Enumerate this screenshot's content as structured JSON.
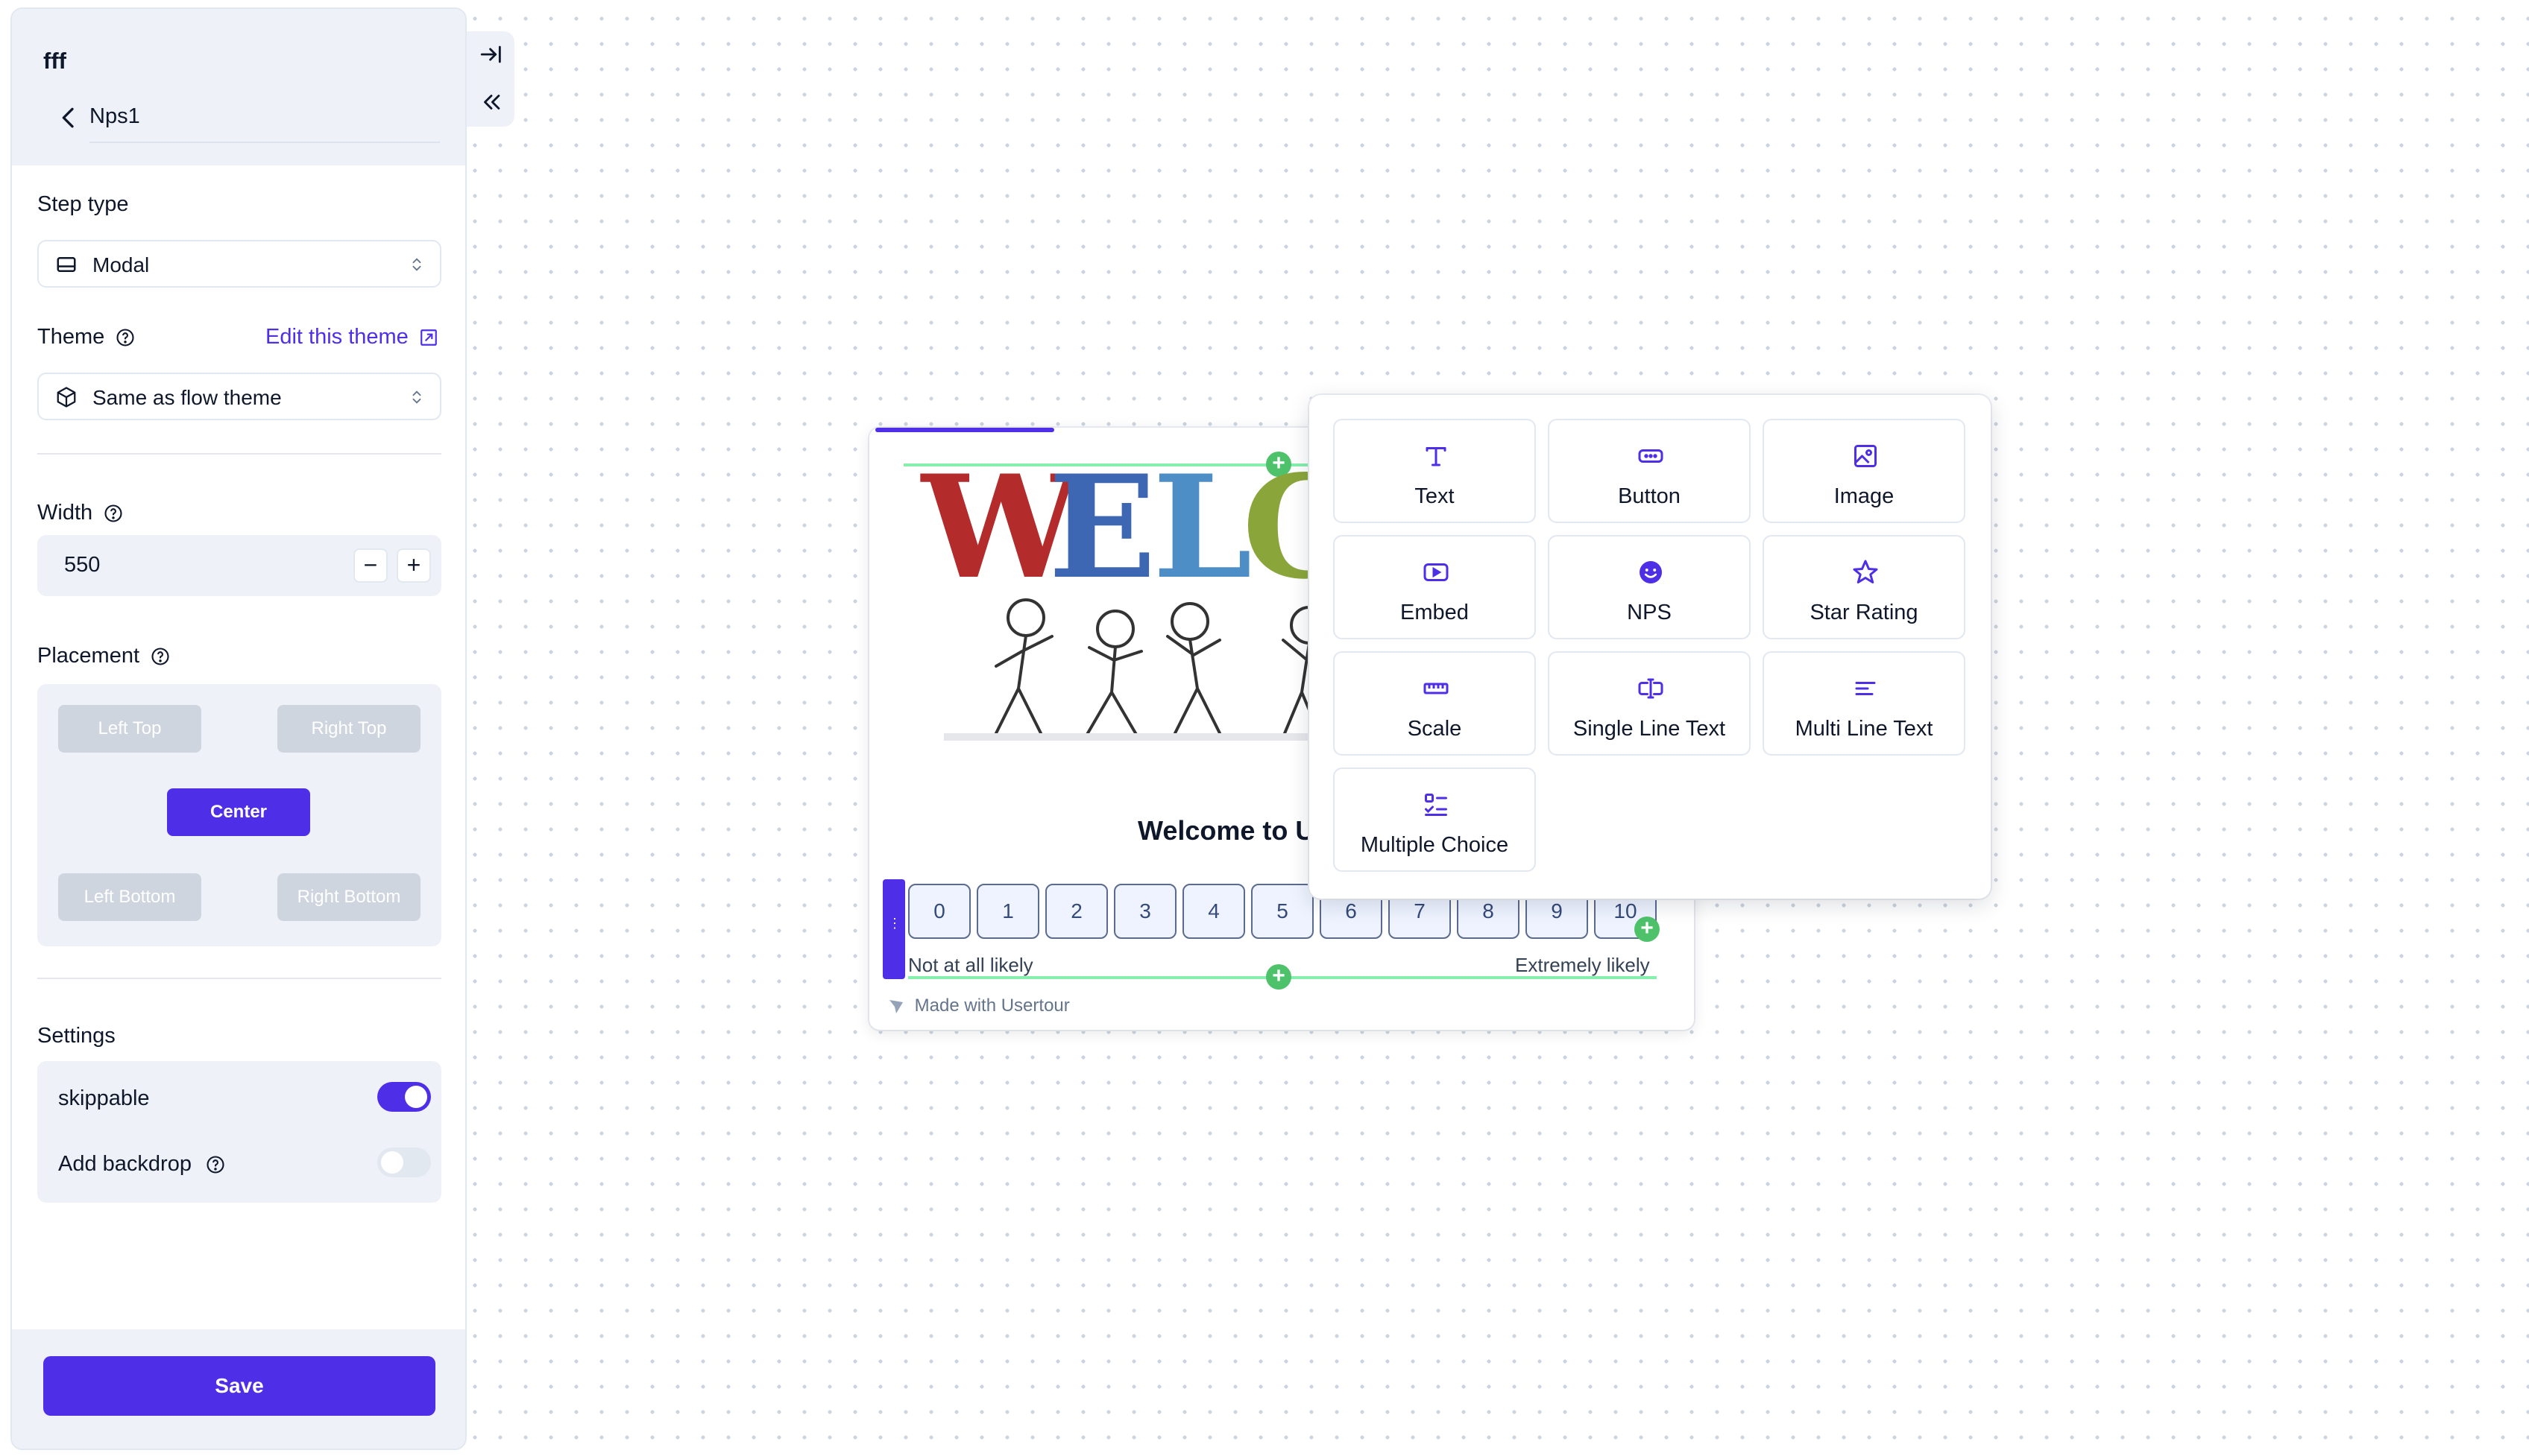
{
  "sidebar": {
    "app_name": "fff",
    "step_name": "Nps1",
    "step_type": {
      "label": "Step type",
      "value": "Modal"
    },
    "theme": {
      "label": "Theme",
      "edit_link": "Edit this theme",
      "value": "Same as flow theme"
    },
    "width": {
      "label": "Width",
      "value": "550"
    },
    "placement": {
      "label": "Placement",
      "options": {
        "left_top": "Left Top",
        "right_top": "Right Top",
        "center": "Center",
        "left_bottom": "Left Bottom",
        "right_bottom": "Right Bottom"
      },
      "selected": "Center"
    },
    "settings": {
      "label": "Settings",
      "skippable": {
        "label": "skippable",
        "on": true
      },
      "backdrop": {
        "label": "Add backdrop",
        "on": false
      }
    },
    "save_label": "Save"
  },
  "modal": {
    "art_text": "WELC",
    "title": "Welcome to U",
    "nps_scale": [
      "0",
      "1",
      "2",
      "3",
      "4",
      "5",
      "6",
      "7",
      "8",
      "9",
      "10"
    ],
    "low_label": "Not at all likely",
    "high_label": "Extremely likely",
    "branding": "Made with Usertour"
  },
  "popup": {
    "items": [
      {
        "label": "Text",
        "icon": "text-icon"
      },
      {
        "label": "Button",
        "icon": "button-icon"
      },
      {
        "label": "Image",
        "icon": "image-icon"
      },
      {
        "label": "Embed",
        "icon": "embed-icon"
      },
      {
        "label": "NPS",
        "icon": "nps-icon"
      },
      {
        "label": "Star Rating",
        "icon": "star-icon"
      },
      {
        "label": "Scale",
        "icon": "ruler-icon"
      },
      {
        "label": "Single Line Text",
        "icon": "text-cursor-icon"
      },
      {
        "label": "Multi Line Text",
        "icon": "multiline-icon"
      },
      {
        "label": "Multiple Choice",
        "icon": "list-check-icon"
      }
    ]
  },
  "colors": {
    "accent": "#4f2ee8",
    "add": "#4ec16b"
  }
}
